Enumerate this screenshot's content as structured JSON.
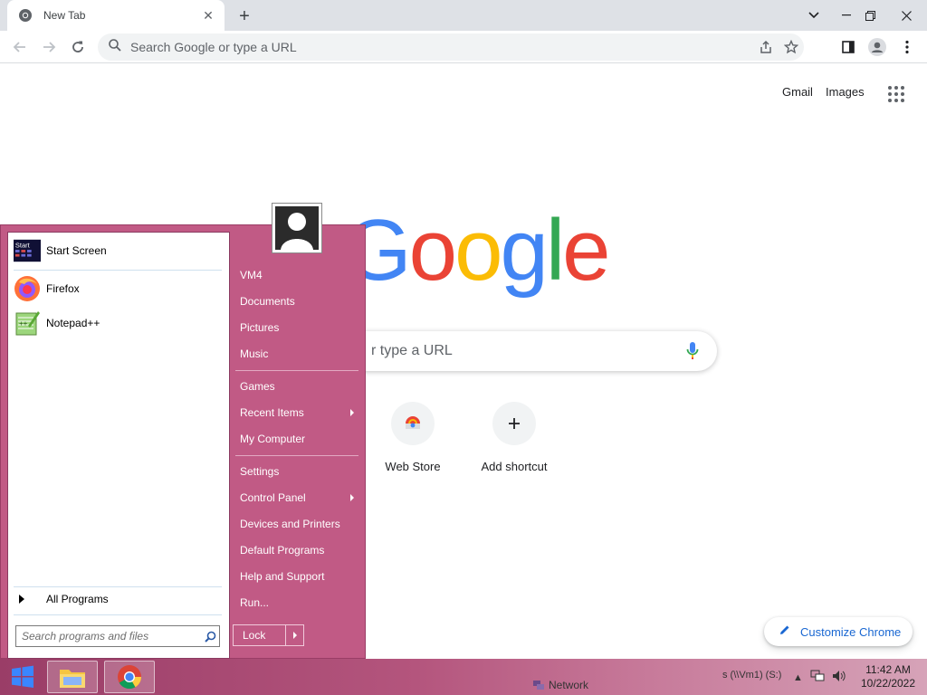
{
  "browser": {
    "tab_title": "New Tab",
    "omnibox_placeholder": "Search Google or type a URL"
  },
  "page": {
    "gmail_link": "Gmail",
    "images_link": "Images",
    "logo_text": "Google",
    "logo_letters": [
      "G",
      "o",
      "o",
      "g",
      "l",
      "e"
    ],
    "logo_colors": [
      "#4285f4",
      "#ea4335",
      "#fbbc05",
      "#4285f4",
      "#34a853",
      "#ea4335"
    ],
    "search_placeholder_visible": "r type a URL",
    "shortcuts": [
      {
        "label": "Web Store",
        "icon": "web-store-icon"
      },
      {
        "label": "Add shortcut",
        "icon": "plus-icon"
      }
    ],
    "customize_label": "Customize Chrome"
  },
  "start_menu": {
    "programs": [
      {
        "label": "Start Screen",
        "icon": "start-screen-icon"
      },
      {
        "label": "Firefox",
        "icon": "firefox-icon"
      },
      {
        "label": "Notepad++",
        "icon": "notepadpp-icon"
      }
    ],
    "start_screen_badge": "Start",
    "all_programs_label": "All Programs",
    "search_placeholder": "Search programs and files",
    "right_items": [
      {
        "label": "VM4",
        "submenu": false
      },
      {
        "label": "Documents",
        "submenu": false
      },
      {
        "label": "Pictures",
        "submenu": false
      },
      {
        "label": "Music",
        "submenu": false
      },
      {
        "label": "Games",
        "submenu": false
      },
      {
        "label": "Recent Items",
        "submenu": true
      },
      {
        "label": "My Computer",
        "submenu": false
      },
      {
        "label": "Settings",
        "submenu": false
      },
      {
        "label": "Control Panel",
        "submenu": true
      },
      {
        "label": "Devices and Printers",
        "submenu": false
      },
      {
        "label": "Default Programs",
        "submenu": false
      },
      {
        "label": "Help and Support",
        "submenu": false
      },
      {
        "label": "Run...",
        "submenu": false
      }
    ],
    "lock_label": "Lock"
  },
  "taskbar": {
    "network_label": "Network",
    "drive_label": "s (\\\\Vm1) (S:)",
    "time": "11:42 AM",
    "date": "10/22/2022",
    "accent": "#b4557d"
  }
}
